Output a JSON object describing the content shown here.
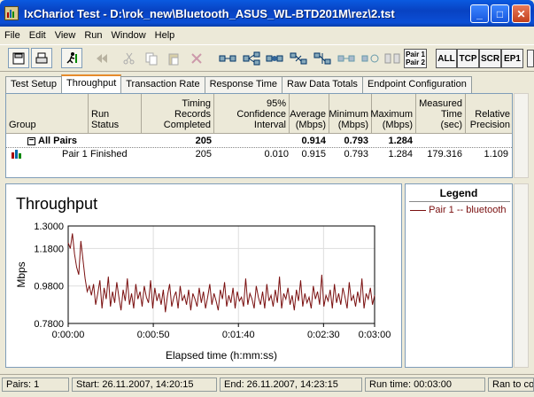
{
  "window": {
    "title": "IxChariot Test - D:\\rok_new\\Bluetooth_ASUS_WL-BTD201M\\rez\\2.tst"
  },
  "menu": [
    "File",
    "Edit",
    "View",
    "Run",
    "Window",
    "Help"
  ],
  "toolbar": {
    "pair_button": [
      "Pair 1",
      "Pair 2"
    ],
    "all": "ALL",
    "tcp": "TCP",
    "scr": "SCR",
    "ep1": "EP1"
  },
  "tabs": [
    {
      "label": "Test Setup"
    },
    {
      "label": "Throughput",
      "active": true
    },
    {
      "label": "Transaction Rate"
    },
    {
      "label": "Response Time"
    },
    {
      "label": "Raw Data Totals"
    },
    {
      "label": "Endpoint Configuration"
    }
  ],
  "grid": {
    "headers": [
      "Group",
      "Run Status",
      "Timing Records Completed",
      "95% Confidence Interval",
      "Average (Mbps)",
      "Minimum (Mbps)",
      "Maximum (Mbps)",
      "Measured Time (sec)",
      "Relative Precision"
    ],
    "all_pairs": {
      "label": "All Pairs",
      "records": "205",
      "average": "0.914",
      "minimum": "0.793",
      "maximum": "1.284"
    },
    "pair1": {
      "label": "Pair 1",
      "status": "Finished",
      "records": "205",
      "ci": "0.010",
      "average": "0.915",
      "minimum": "0.793",
      "maximum": "1.284",
      "time": "179.316",
      "precision": "1.109"
    }
  },
  "chart_data": {
    "type": "line",
    "title": "Throughput",
    "xlabel": "Elapsed time (h:mm:ss)",
    "ylabel": "Mbps",
    "xlim": [
      0,
      180
    ],
    "ylim": [
      0.78,
      1.3
    ],
    "x_ticks": [
      "0:00:00",
      "0:00:50",
      "0:01:40",
      "0:02:30",
      "0:03:00"
    ],
    "y_ticks": [
      "1.3000",
      "1.1800",
      "0.9800",
      "0.7800"
    ],
    "series": [
      {
        "name": "Pair 1 -- bluetooth",
        "color": "#7a1010",
        "values": [
          1.21,
          1.18,
          1.26,
          1.15,
          1.08,
          1.04,
          1.22,
          1.12,
          1.02,
          0.95,
          0.98,
          0.93,
          0.99,
          0.88,
          0.94,
          1.01,
          0.86,
          0.97,
          0.91,
          1.03,
          0.87,
          0.95,
          0.89,
          1.0,
          0.92,
          0.85,
          0.96,
          0.9,
          1.02,
          0.88,
          0.94,
          0.86,
          0.99,
          0.91,
          0.95,
          0.87,
          0.98,
          0.92,
          0.89,
          1.01,
          0.86,
          0.97,
          0.9,
          0.94,
          0.88,
          0.96,
          0.84,
          0.93,
          0.99,
          0.87,
          0.92,
          0.95,
          0.86,
          0.98,
          0.9,
          0.93,
          0.88,
          0.96,
          0.85,
          0.94,
          0.91,
          0.87,
          0.97,
          0.89,
          0.95,
          0.86,
          0.92,
          0.99,
          0.88,
          0.94,
          0.9,
          0.85,
          0.96,
          0.91,
          1.0,
          0.87,
          0.93,
          0.89,
          0.97,
          0.86,
          0.95,
          0.9,
          0.92,
          0.87,
          1.02,
          0.88,
          0.94,
          0.91,
          0.86,
          0.98,
          0.92,
          0.88,
          0.95,
          0.86,
          0.99,
          0.9,
          0.93,
          0.87,
          0.96,
          0.89,
          1.03,
          0.86,
          0.94,
          0.91,
          0.97,
          0.88,
          0.93,
          0.85,
          0.96,
          0.9,
          1.01,
          0.87,
          0.94,
          0.89,
          0.92,
          0.86,
          0.98,
          0.91,
          0.95,
          0.88,
          1.04,
          0.87,
          0.93,
          0.9,
          0.96,
          0.86,
          0.99,
          0.89,
          0.94,
          0.88,
          0.97,
          0.92,
          0.86,
          1.0,
          0.9,
          0.93,
          0.87,
          0.95,
          0.89,
          1.02,
          0.86,
          0.94,
          0.91,
          0.97,
          0.88,
          0.93
        ]
      }
    ]
  },
  "legend": {
    "title": "Legend",
    "items": [
      "Pair 1 -- bluetooth"
    ]
  },
  "status": {
    "pairs": "Pairs: 1",
    "start": "Start: 26.11.2007, 14:20:15",
    "end": "End: 26.11.2007, 14:23:15",
    "run_time": "Run time: 00:03:00",
    "ran_to": "Ran to co"
  }
}
